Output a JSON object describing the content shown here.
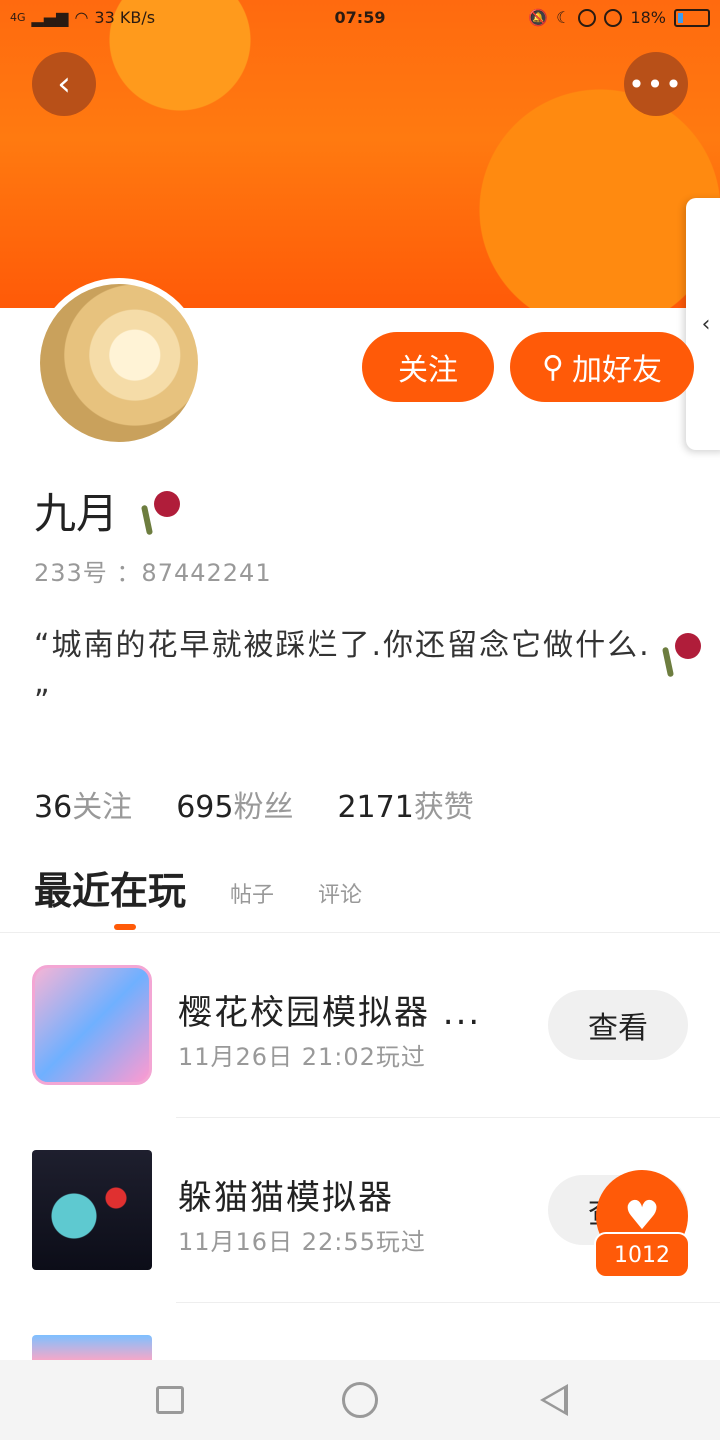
{
  "status_bar": {
    "network": "4G",
    "speed": "33 KB/s",
    "time": "07:59",
    "battery": "18%",
    "battery_level": 0.18
  },
  "header": {
    "back_icon": "chevron-left-icon",
    "more_icon": "more-horizontal-icon",
    "side_tab_icon": "chevron-left-icon"
  },
  "profile": {
    "follow_label": "关注",
    "add_friend_label": "加好友",
    "name": "九月",
    "id_label": "233号 ：87442241",
    "bio": "“城南的花早就被踩烂了.你还留念它做什么.",
    "bio_end": "”"
  },
  "stats": [
    {
      "value": "36",
      "label": "关注"
    },
    {
      "value": "695",
      "label": "粉丝"
    },
    {
      "value": "2171",
      "label": "获赞"
    }
  ],
  "tabs": {
    "active": "最近在玩",
    "posts": "帖子",
    "comments": "评论"
  },
  "games": [
    {
      "title": "樱花校园模拟器 ...",
      "time": "11月26日 21:02玩过",
      "button": "查看"
    },
    {
      "title": "躲猫猫模拟器",
      "time": "11月16日 22:55玩过",
      "button": "查看"
    }
  ],
  "likes": {
    "count": "1012",
    "icon": "heart-icon"
  },
  "colors": {
    "accent": "#ff5a08",
    "banner": "#ff6a0f",
    "muted_text": "#999999"
  }
}
